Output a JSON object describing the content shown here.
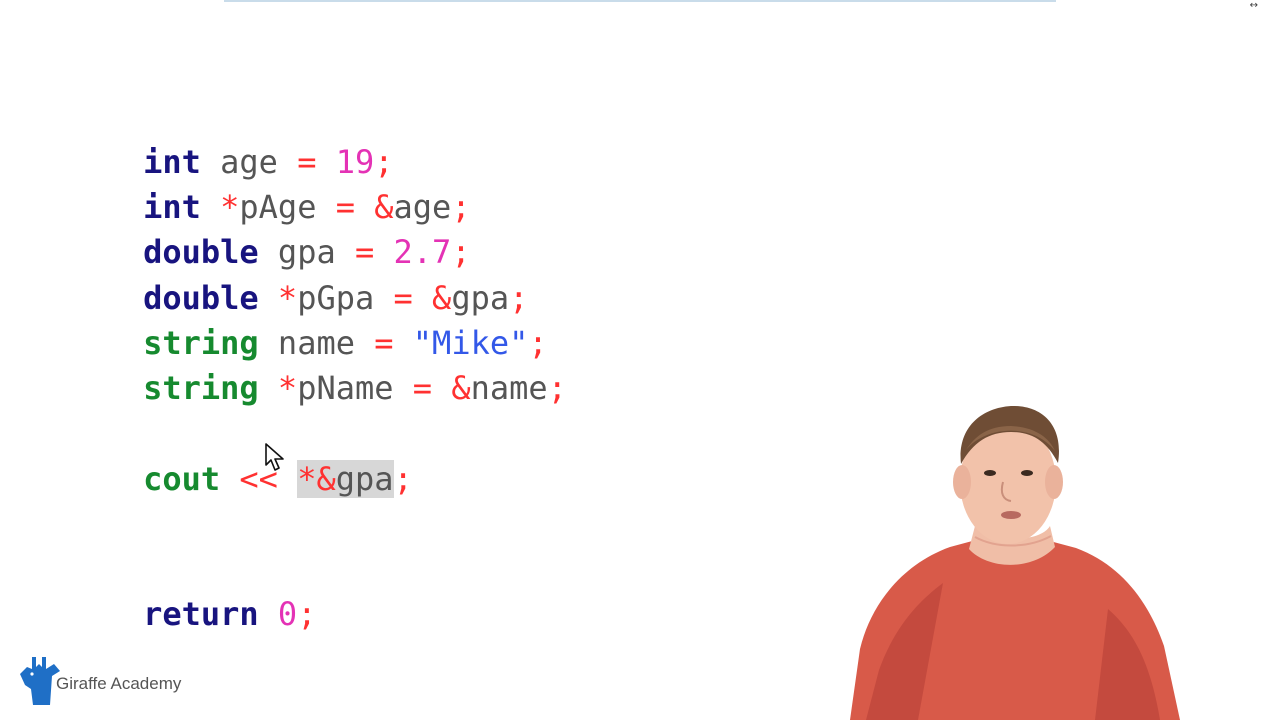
{
  "code": {
    "line1": {
      "keyword": "int",
      "name": "age",
      "operator": "=",
      "value": "19",
      "terminator": ";"
    },
    "line2": {
      "keyword": "int",
      "pointer": "*",
      "name": "pAge",
      "operator": "=",
      "address": "&",
      "target": "age",
      "terminator": ";"
    },
    "line3": {
      "keyword": "double",
      "name": "gpa",
      "operator": "=",
      "value": "2.7",
      "terminator": ";"
    },
    "line4": {
      "keyword": "double",
      "pointer": "*",
      "name": "pGpa",
      "operator": "=",
      "address": "&",
      "target": "gpa",
      "terminator": ";"
    },
    "line5": {
      "keyword": "string",
      "name": "name",
      "operator": "=",
      "value": "\"Mike\"",
      "terminator": ";"
    },
    "line6": {
      "keyword": "string",
      "pointer": "*",
      "name": "pName",
      "operator": "=",
      "address": "&",
      "target": "name",
      "terminator": ";"
    },
    "line7": {
      "keyword": "cout",
      "operator": "<<",
      "selected_star": "*",
      "selected_amp": "&",
      "selected_name": "gpa",
      "terminator": ";"
    },
    "line8": {
      "keyword": "return",
      "value": "0",
      "terminator": ";"
    }
  },
  "corner_mark": "↔",
  "brand": {
    "label": "Giraffe Academy",
    "icon": "giraffe-icon",
    "color": "#1f6fc6"
  },
  "icons": {
    "cursor": "mouse-pointer-icon",
    "presenter": "presenter-video"
  },
  "colors": {
    "blue_keyword": "#18147f",
    "green_keyword": "#168a2f",
    "operator": "#ff3131",
    "number": "#e432b5",
    "string": "#3358e8",
    "identifier": "#555555",
    "selection": "#d7d7d7"
  }
}
